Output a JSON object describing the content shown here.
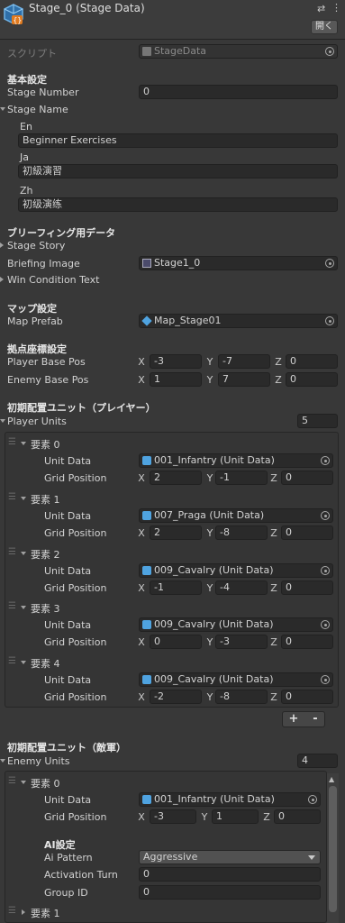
{
  "header": {
    "title": "Stage_0 (Stage Data)",
    "open_button": "開く"
  },
  "script": {
    "label": "スクリプト",
    "value": "StageData"
  },
  "basic": {
    "section": "基本設定",
    "stage_number_label": "Stage Number",
    "stage_number": "0",
    "stage_name_label": "Stage Name",
    "en_label": "En",
    "en_value": "Beginner Exercises",
    "ja_label": "Ja",
    "ja_value": "初級演習",
    "zh_label": "Zh",
    "zh_value": "初级演练"
  },
  "briefing": {
    "section": "ブリーフィング用データ",
    "story_label": "Stage Story",
    "image_label": "Briefing Image",
    "image_value": "Stage1_0",
    "win_label": "Win Condition Text"
  },
  "map": {
    "section": "マップ設定",
    "prefab_label": "Map Prefab",
    "prefab_value": "Map_Stage01"
  },
  "bases": {
    "section": "拠点座標設定",
    "player_label": "Player Base Pos",
    "player": {
      "x": "-3",
      "y": "-7",
      "z": "0"
    },
    "enemy_label": "Enemy Base Pos",
    "enemy": {
      "x": "1",
      "y": "7",
      "z": "0"
    }
  },
  "axis": {
    "x": "X",
    "y": "Y",
    "z": "Z"
  },
  "player_units": {
    "section": "初期配置ユニット（プレイヤー）",
    "label": "Player Units",
    "count": "5",
    "unit_data_label": "Unit Data",
    "grid_label": "Grid Position",
    "items": [
      {
        "label": "要素 0",
        "unit": "001_Infantry (Unit Data)",
        "x": "2",
        "y": "-1",
        "z": "0"
      },
      {
        "label": "要素 1",
        "unit": "007_Praga (Unit Data)",
        "x": "2",
        "y": "-8",
        "z": "0"
      },
      {
        "label": "要素 2",
        "unit": "009_Cavalry (Unit Data)",
        "x": "-1",
        "y": "-4",
        "z": "0"
      },
      {
        "label": "要素 3",
        "unit": "009_Cavalry (Unit Data)",
        "x": "0",
        "y": "-3",
        "z": "0"
      },
      {
        "label": "要素 4",
        "unit": "009_Cavalry (Unit Data)",
        "x": "-2",
        "y": "-8",
        "z": "0"
      }
    ],
    "plus": "+",
    "minus": "-"
  },
  "enemy_units": {
    "section": "初期配置ユニット（敵軍）",
    "label": "Enemy Units",
    "count": "4",
    "item0": {
      "label": "要素 0",
      "unit": "001_Infantry (Unit Data)",
      "x": "-3",
      "y": "1",
      "z": "0"
    },
    "ai_section": "AI設定",
    "ai_pattern_label": "Ai Pattern",
    "ai_pattern_value": "Aggressive",
    "activation_label": "Activation Turn",
    "activation_value": "0",
    "group_label": "Group ID",
    "group_value": "0",
    "item1_label": "要素 1"
  },
  "colors": {
    "background": "#383838",
    "field": "#2a2a2a",
    "accent": "#4fa3e0"
  }
}
